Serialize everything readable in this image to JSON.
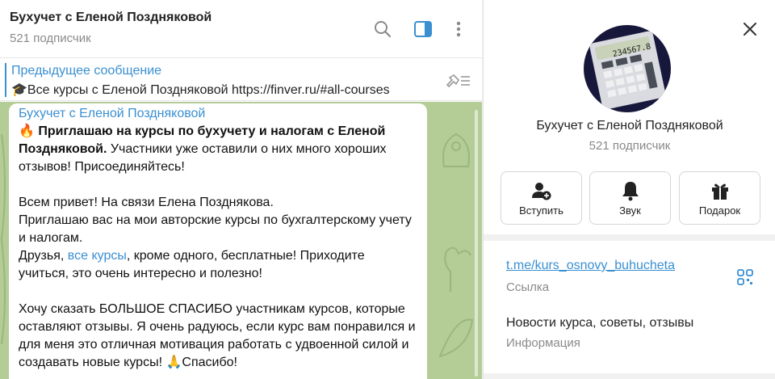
{
  "chat": {
    "title": "Бухучет с Еленой Поздняковой",
    "subtitle": "521 подписчик",
    "pinned": {
      "label": "Предыдущее сообщение",
      "text": "🎓Все курсы с Еленой Поздняковой https://finver.ru/#all-courses"
    },
    "message": {
      "author": "Бухучет с Еленой Поздняковой",
      "fire": "🔥",
      "bold_line": "Приглашаю на курсы по бухучету и налогам с Еленой Поздняковой.",
      "line1_rest": "Участники уже оставили о них много хороших отзывов! Присоединяйтесь!",
      "para2_a": "Всем привет! На связи Елена Позднякова.",
      "para2_b": "Приглашаю вас на мои авторские курсы по бухгалтерскому учету и налогам.",
      "para2_c_pre": "Друзья,",
      "para2_c_link": "все курсы",
      "para2_c_post": ", кроме одного, бесплатные! Приходите учиться, это очень интересно и полезно!",
      "para3": "Хочу сказать БОЛЬШОЕ СПАСИБО участникам курсов, которые оставляют отзывы. Я очень радуюсь, если курс вам понравился и для меня это отличная мотивация работать с удвоенной силой и создавать новые курсы!",
      "para3_end": "🙏Спасибо!"
    }
  },
  "panel": {
    "name": "Бухучет с Еленой Поздняковой",
    "subtitle": "521 подписчик",
    "avatar_display": "234567.8",
    "actions": [
      {
        "label": "Вступить",
        "icon": "add-user-icon"
      },
      {
        "label": "Звук",
        "icon": "bell-icon"
      },
      {
        "label": "Подарок",
        "icon": "gift-icon"
      }
    ],
    "link": "t.me/kurs_osnovy_buhucheta",
    "link_label": "Ссылка",
    "description": "Новости курса, советы, отзывы",
    "description_label": "Информация"
  },
  "colors": {
    "accent": "#3a8fd1",
    "wallpaper": "#b4cc96",
    "avatar_bg": "#16173a"
  }
}
